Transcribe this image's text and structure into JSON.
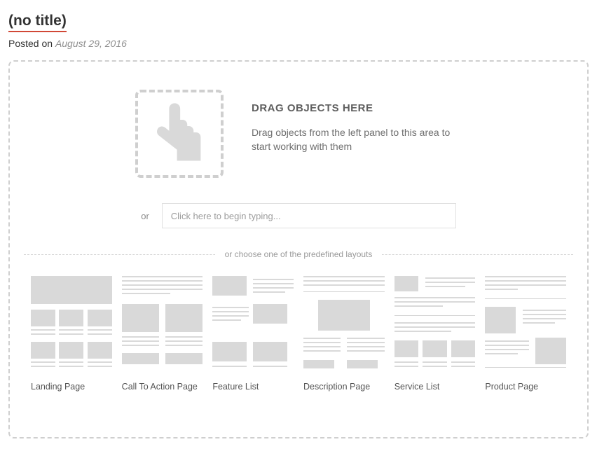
{
  "header": {
    "title": "(no title)",
    "posted_prefix": "Posted on ",
    "posted_date": "August 29, 2016"
  },
  "drag": {
    "heading": "DRAG OBJECTS HERE",
    "instructions": "Drag objects from the left panel to this area to start working with them"
  },
  "or_row": {
    "or_label": "or",
    "placeholder": "Click here to begin typing..."
  },
  "layouts": {
    "divider": "or choose one of the predefined layouts",
    "options": [
      "Landing Page",
      "Call To Action Page",
      "Feature List",
      "Description Page",
      "Service List",
      "Product Page"
    ]
  }
}
